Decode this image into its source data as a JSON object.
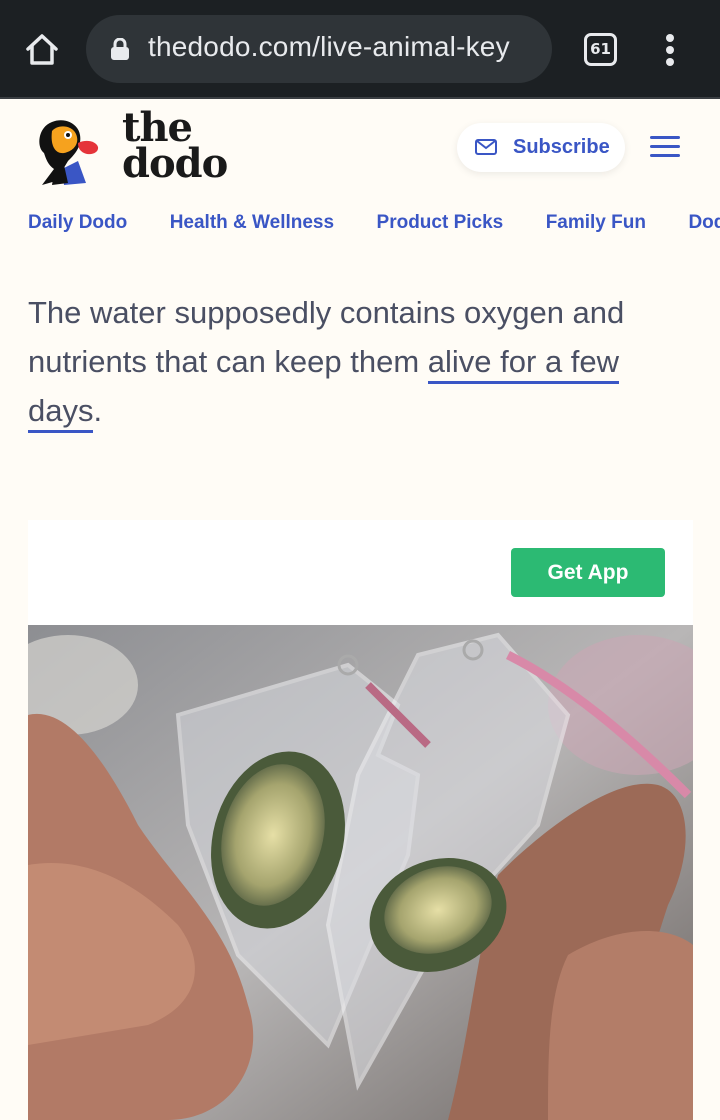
{
  "browser": {
    "url": "thedodo.com/live-animal-key",
    "tab_count": "61",
    "icons": [
      "home-icon",
      "lock-icon",
      "tab-switcher-icon",
      "more-menu-icon"
    ]
  },
  "site": {
    "logo_line1": "the",
    "logo_line2": "dodo",
    "subscribe_label": "Subscribe",
    "nav_items": [
      "Daily Dodo",
      "Health & Wellness",
      "Product Picks",
      "Family Fun",
      "Dodo"
    ]
  },
  "article": {
    "text_before_link": "The water supposedly contains oxygen and nutrients that can keep them ",
    "link_text": "alive for a few days",
    "text_after_link": "."
  },
  "app_banner": {
    "button_label": "Get App"
  },
  "colors": {
    "chrome_bg": "#1c2023",
    "page_bg": "#fffcf6",
    "brand_blue": "#3a56c5",
    "get_app_green": "#2cba73"
  }
}
